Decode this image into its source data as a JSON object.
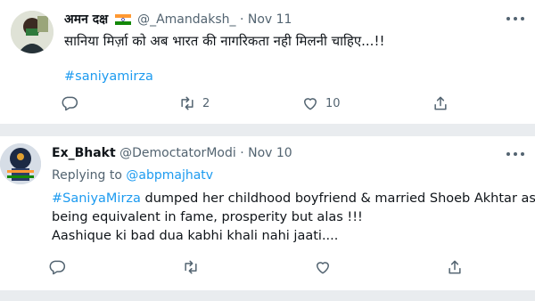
{
  "tweets": [
    {
      "author_name": "अमन दक्ष",
      "handle": "@_Amandaksh_",
      "separator": "·",
      "date": "Nov 11",
      "text": "सानिया मिर्ज़ा को अब भारत की नागरिकता नही मिलनी चाहिए...!!",
      "hashtag": "#saniyamirza",
      "actions": {
        "reply_count": "",
        "retweet_count": "2",
        "like_count": "10"
      }
    },
    {
      "author_name": "Ex_Bhakt",
      "handle": "@DemoctatorModi",
      "separator": "·",
      "date": "Nov 10",
      "replying_prefix": "Replying to",
      "replying_to": "@abpmajhatv",
      "hashtag": "#SaniyaMirza",
      "text_line1_rest": " dumped her childhood boyfriend & married Shoeb Akhtar as",
      "text_line2": "being equivalent in fame, prosperity but alas !!!",
      "text_line3": "Aashique ki bad dua kabhi khali nahi jaati....",
      "actions": {
        "reply_count": "",
        "retweet_count": "",
        "like_count": ""
      }
    }
  ],
  "icons": {
    "reply": "reply-icon",
    "retweet": "retweet-icon",
    "like": "heart-icon",
    "share": "share-icon",
    "more": "more-icon",
    "flag": "india-flag-icon"
  },
  "colors": {
    "link": "#1d9bf0",
    "secondary": "#536471",
    "text": "#0f1419"
  }
}
